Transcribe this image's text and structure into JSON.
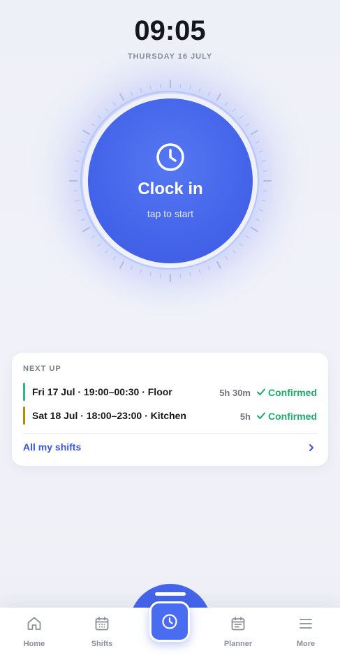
{
  "clock": {
    "time": "09:05",
    "date": "THURSDAY 16 JULY"
  },
  "action": {
    "label": "Clock in",
    "sublabel": "tap to start",
    "icon": "clock-icon"
  },
  "next_up": {
    "title": "NEXT UP",
    "shifts": [
      {
        "description": "Fri 17 Jul · 19:00–00:30 · Floor",
        "duration": "5h 30m",
        "status": "Confirmed",
        "color": "#2fb87a"
      },
      {
        "description": "Sat 18 Jul · 18:00–23:00 · Kitchen",
        "duration": "5h",
        "status": "Confirmed",
        "color": "#b08a10"
      }
    ],
    "all_link": "All my shifts"
  },
  "tabs": [
    {
      "label": "Home",
      "icon": "home-icon"
    },
    {
      "label": "Shifts",
      "icon": "calendar-icon"
    },
    {
      "label": "Planner",
      "icon": "planner-icon"
    },
    {
      "label": "More",
      "icon": "menu-icon"
    }
  ],
  "colors": {
    "accent": "#4566ea",
    "success": "#1fa86b"
  }
}
